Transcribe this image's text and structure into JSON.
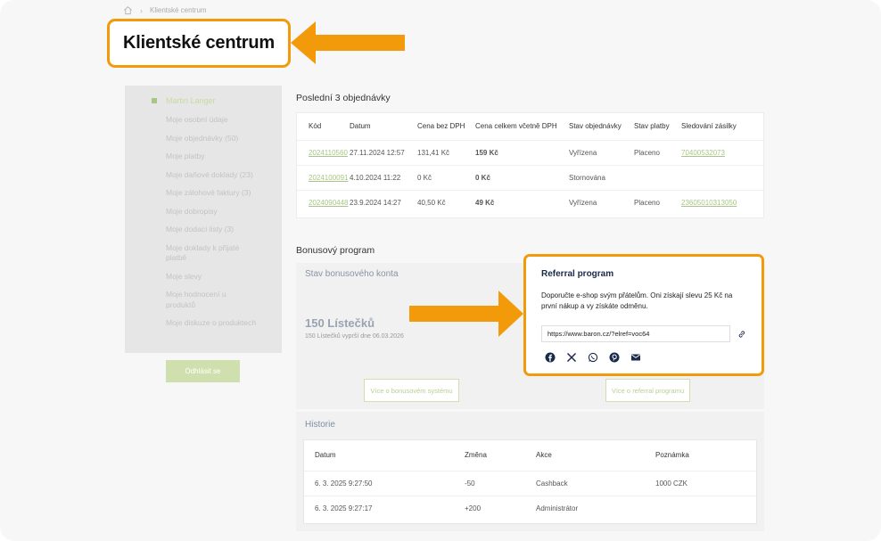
{
  "breadcrumb": {
    "current": "Klientské centrum"
  },
  "page_title": "Klientské centrum",
  "sidebar": {
    "user": "Martin Langer",
    "items": [
      "Moje osobní údaje",
      "Moje objednávky (50)",
      "Moje platby",
      "Moje daňové doklady (23)",
      "Moje zálohové faktury (3)",
      "Moje dobropisy",
      "Moje dodací listy (3)",
      "Moje doklady k přijaté platbě",
      "Moje slevy",
      "Moje hodnocení u produktů",
      "Moje diskuze o produktech"
    ],
    "logout": "Odhlásit se"
  },
  "orders": {
    "title": "Poslední 3 objednávky",
    "headers": [
      "Kód",
      "Datum",
      "Cena bez DPH",
      "Cena celkem včetně DPH",
      "Stav objednávky",
      "Stav platby",
      "Sledování zásilky"
    ],
    "rows": [
      [
        "2024110560",
        "27.11.2024 12:57",
        "131,41 Kč",
        "159 Kč",
        "Vyřízena",
        "Placeno",
        "70400532073"
      ],
      [
        "2024100091",
        "4.10.2024 11:22",
        "0 Kč",
        "0 Kč",
        "Stornována",
        "",
        ""
      ],
      [
        "2024090448",
        "23.9.2024 14:27",
        "40,50 Kč",
        "49 Kč",
        "Vyřízena",
        "Placeno",
        "23605010313050"
      ]
    ]
  },
  "bonus": {
    "section_title": "Bonusový program",
    "account_title": "Stav bonusového konta",
    "balance": "150 Lístečků",
    "expiry": "150 Lístečků vyprší dne 06.03.2026",
    "bonus_button": "Více o bonusovém systému",
    "referral_button": "Více o referral programu"
  },
  "referral": {
    "title": "Referral program",
    "text": "Doporučte e-shop svým přátelům. Oni získají slevu 25 Kč na první nákup a vy získáte odměnu.",
    "url": "https://www.baron.cz/?elref=voc64",
    "share_icons": [
      "facebook-icon",
      "x-icon",
      "whatsapp-icon",
      "pinterest-icon",
      "mail-icon"
    ]
  },
  "history": {
    "title": "Historie",
    "headers": [
      "Datum",
      "Změna",
      "Akce",
      "Poznámka"
    ],
    "rows": [
      [
        "6. 3. 2025 9:27:50",
        "-50",
        "Cashback",
        "1000 CZK"
      ],
      [
        "6. 3. 2025 9:27:17",
        "+200",
        "Administrátor",
        ""
      ]
    ]
  },
  "colors": {
    "highlight": "#f29a0a",
    "accent": "#a9c586"
  }
}
